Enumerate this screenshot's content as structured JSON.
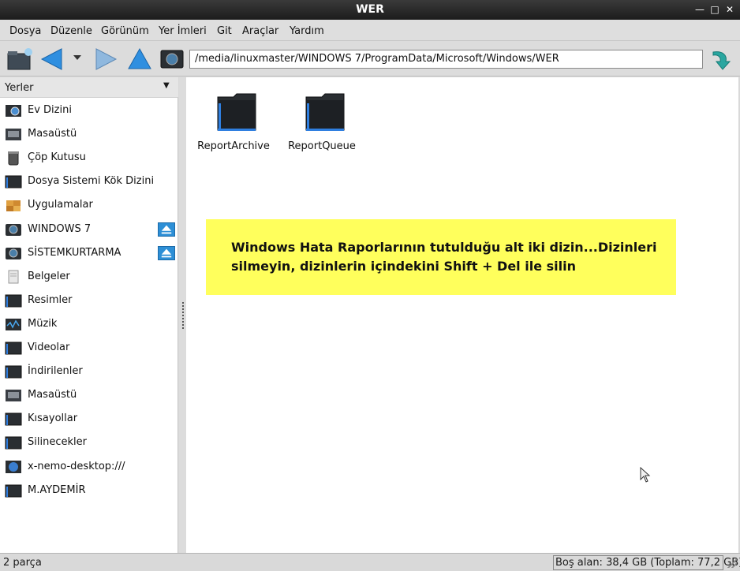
{
  "window": {
    "title": "WER"
  },
  "menu": [
    {
      "label": "Dosya"
    },
    {
      "label": "Düzenle"
    },
    {
      "label": "Görünüm"
    },
    {
      "label": "Yer İmleri"
    },
    {
      "label": "Git"
    },
    {
      "label": "Araçlar"
    },
    {
      "label": "Yardım"
    }
  ],
  "toolbar": {
    "path": "/media/linuxmaster/WINDOWS 7/ProgramData/Microsoft/Windows/WER"
  },
  "sidebar": {
    "header": "Yerler",
    "items": [
      {
        "label": "Ev Dizini",
        "icon": "home-folder-icon"
      },
      {
        "label": "Masaüstü",
        "icon": "desktop-icon"
      },
      {
        "label": "Çöp Kutusu",
        "icon": "trash-icon"
      },
      {
        "label": "Dosya Sistemi Kök Dizini",
        "icon": "drive-icon"
      },
      {
        "label": "Uygulamalar",
        "icon": "applications-icon"
      },
      {
        "label": "WINDOWS 7",
        "icon": "disk-icon",
        "eject": true
      },
      {
        "label": "SİSTEMKURTARMA",
        "icon": "disk-icon",
        "eject": true
      },
      {
        "label": "Belgeler",
        "icon": "documents-icon"
      },
      {
        "label": "Resimler",
        "icon": "folder-icon"
      },
      {
        "label": "Müzik",
        "icon": "music-folder-icon"
      },
      {
        "label": "Videolar",
        "icon": "folder-icon"
      },
      {
        "label": "İndirilenler",
        "icon": "folder-icon"
      },
      {
        "label": "Masaüstü",
        "icon": "desktop-icon"
      },
      {
        "label": "Kısayollar",
        "icon": "folder-icon"
      },
      {
        "label": "Silinecekler",
        "icon": "folder-icon"
      },
      {
        "label": "x-nemo-desktop:///",
        "icon": "network-icon"
      },
      {
        "label": "M.AYDEMİR",
        "icon": "folder-icon"
      }
    ]
  },
  "files": [
    {
      "name": "ReportArchive"
    },
    {
      "name": "ReportQueue"
    }
  ],
  "note": {
    "text": "Windows Hata Raporlarının tutulduğu alt iki dizin...Dizinleri silmeyin, dizinlerin içindekini Shift + Del ile silin",
    "color": "#ffff5c"
  },
  "status": {
    "left": "2 parça",
    "right": "Boş alan: 38,4 GB (Toplam: 77,2 GB)"
  }
}
